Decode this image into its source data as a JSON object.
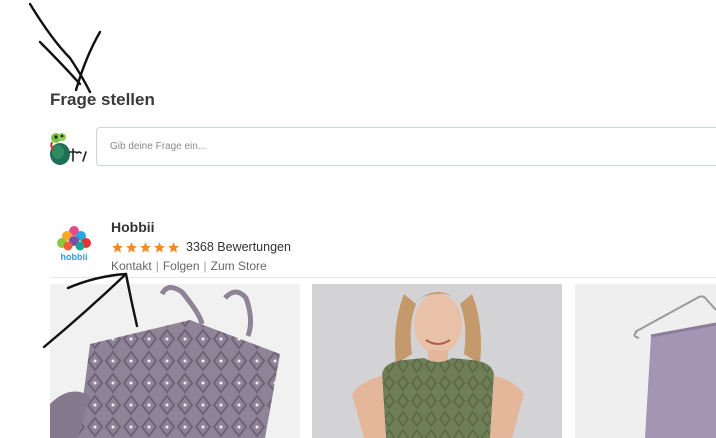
{
  "question": {
    "title": "Frage stellen",
    "input_placeholder": "Gib deine Frage ein..."
  },
  "shop": {
    "name": "Hobbii",
    "logo_text": "hobbii",
    "rating_stars": 5,
    "reviews_label": "3368 Bewertungen",
    "links": [
      "Kontakt",
      "Folgen",
      "Zum Store"
    ]
  },
  "products": [
    {
      "icon": "knitted-bag-photo"
    },
    {
      "icon": "knitted-top-photo"
    },
    {
      "icon": "knitted-sweater-on-hanger-photo"
    }
  ],
  "colors": {
    "star": "#f28c28",
    "input_border": "#cfd6d9",
    "lilac_yarn": "#8f8497",
    "sage_yarn": "#6f7f55"
  }
}
